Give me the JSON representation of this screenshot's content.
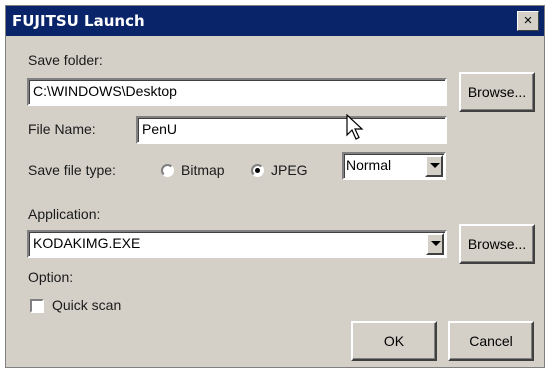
{
  "window": {
    "title": "FUJITSU Launch",
    "close_glyph": "×"
  },
  "save_folder": {
    "label": "Save folder:",
    "value": "C:\\WINDOWS\\Desktop",
    "browse_label": "Browse..."
  },
  "file_name": {
    "label": "File Name:",
    "value": "PenU"
  },
  "save_file_type": {
    "label": "Save file type:",
    "options": [
      {
        "label": "Bitmap",
        "selected": false
      },
      {
        "label": "JPEG",
        "selected": true
      }
    ],
    "quality_selected": "Normal"
  },
  "application": {
    "label": "Application:",
    "selected": "KODAKIMG.EXE",
    "browse_label": "Browse..."
  },
  "option": {
    "label": "Option:",
    "quick_scan_label": "Quick scan",
    "quick_scan_checked": false
  },
  "footer": {
    "ok_label": "OK",
    "cancel_label": "Cancel"
  },
  "icons": {
    "cursor": "mouse-pointer-icon"
  }
}
